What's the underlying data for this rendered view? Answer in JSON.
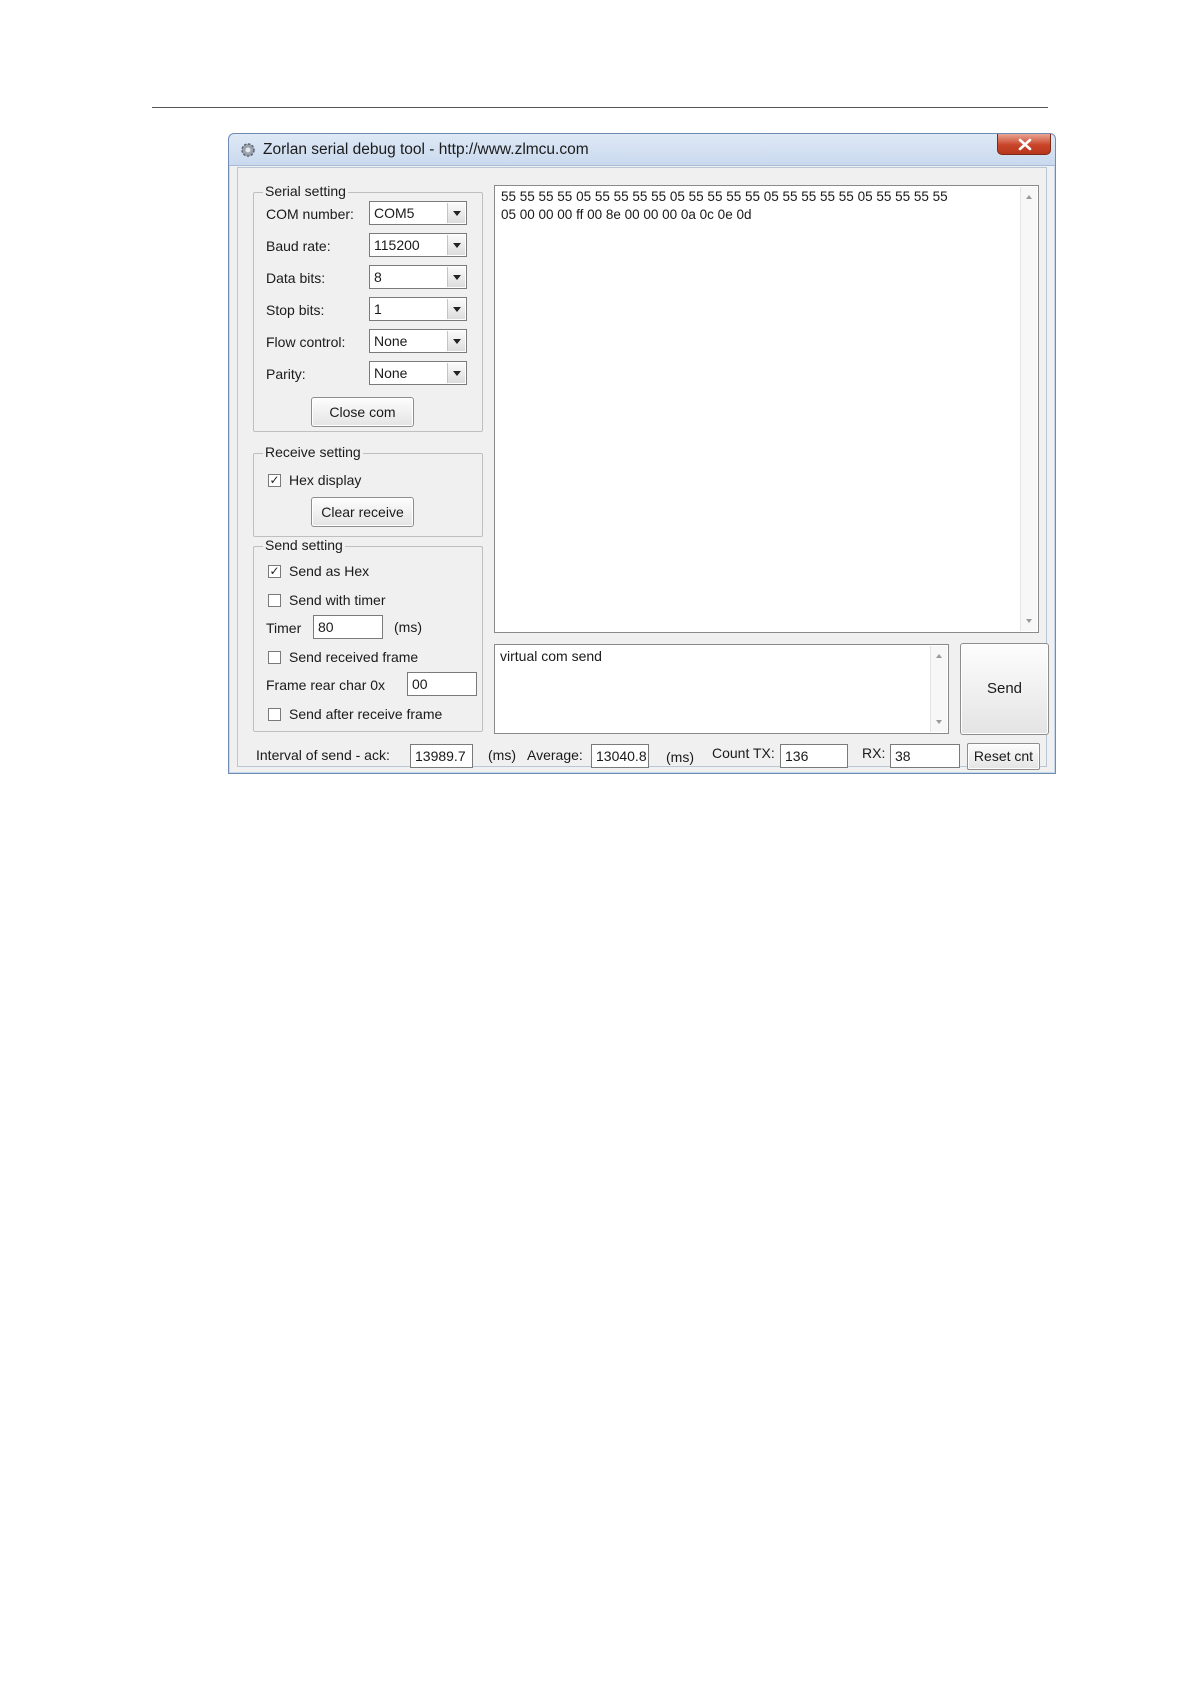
{
  "window": {
    "title": "Zorlan serial debug tool - http://www.zlmcu.com"
  },
  "serial_setting": {
    "title": "Serial setting",
    "com_label": "COM number:",
    "com_value": "COM5",
    "baud_label": "Baud rate:",
    "baud_value": "115200",
    "data_bits_label": "Data bits:",
    "data_bits_value": "8",
    "stop_bits_label": "Stop bits:",
    "stop_bits_value": "1",
    "flow_label": "Flow control:",
    "flow_value": "None",
    "parity_label": "Parity:",
    "parity_value": "None",
    "close_button": "Close com"
  },
  "receive_setting": {
    "title": "Receive setting",
    "hex_display_label": "Hex display",
    "hex_display_checked": true,
    "clear_button": "Clear receive"
  },
  "send_setting": {
    "title": "Send setting",
    "send_as_hex_label": "Send as Hex",
    "send_as_hex_checked": true,
    "send_with_timer_label": "Send with timer",
    "send_with_timer_checked": false,
    "timer_label": "Timer",
    "timer_value": "80",
    "timer_unit": "(ms)",
    "send_received_frame_label": "Send received frame",
    "send_received_frame_checked": false,
    "frame_rear_label": "Frame rear char 0x",
    "frame_rear_value": "00",
    "send_after_receive_label": "Send after receive frame",
    "send_after_receive_checked": false
  },
  "receive_area": {
    "line1": "55 55 55 55 05 55 55 55 55 05 55 55 55 55 05 55 55 55 55 05 55 55 55 55",
    "line2": "05 00 00 00 ff 00 8e 00 00 00 0a 0c 0e 0d"
  },
  "send_area": {
    "text": "virtual com send",
    "send_button": "Send"
  },
  "status_bar": {
    "interval_label": "Interval of send - ack:",
    "interval_value": "13989.7",
    "ms_label_1": "(ms)",
    "average_label": "Average:",
    "average_value": "13040.8",
    "ms_label_2": "(ms)",
    "count_tx_label": "Count TX:",
    "count_tx_value": "136",
    "rx_label": "RX:",
    "rx_value": "38",
    "reset_button": "Reset cnt"
  }
}
